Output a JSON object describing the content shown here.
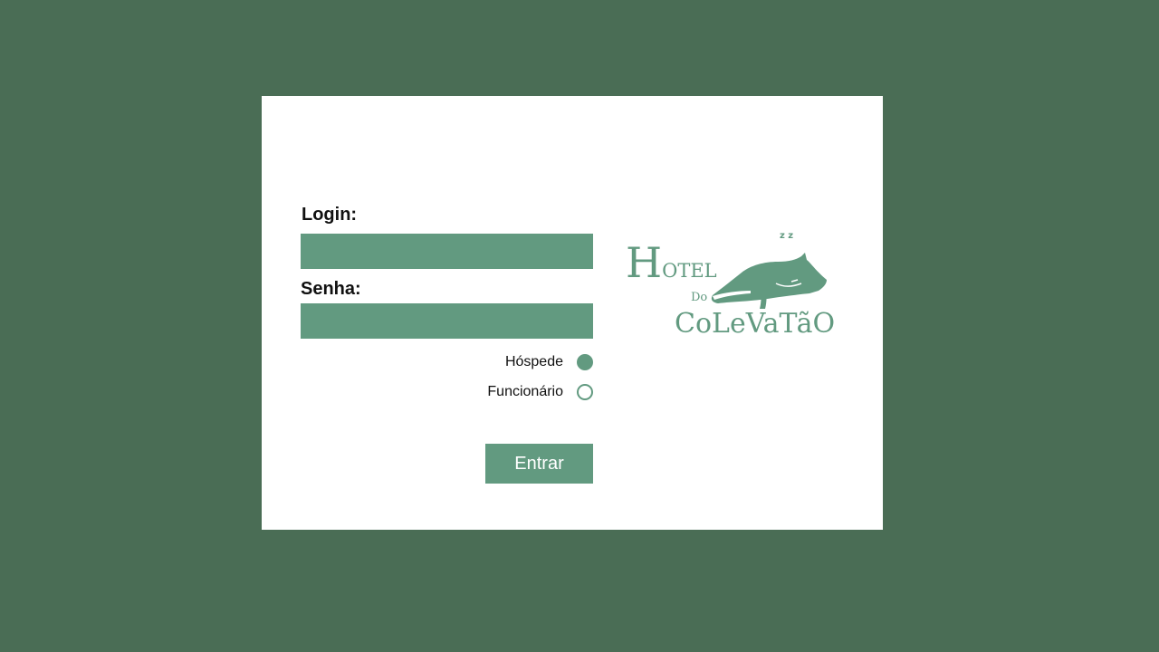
{
  "form": {
    "login_label": "Login:",
    "login_value": "",
    "senha_label": "Senha:",
    "senha_value": "",
    "role_options": [
      {
        "label": "Hóspede",
        "checked": true
      },
      {
        "label": "Funcionário",
        "checked": false
      }
    ],
    "submit_label": "Entrar"
  },
  "logo": {
    "line1_big": "H",
    "line1_rest": "OTEL",
    "line2": "Do",
    "line3": "CoLeVaTãO",
    "zz": "z z",
    "icon": "sleeping-dog-icon"
  },
  "colors": {
    "background": "#4a6d55",
    "card": "#ffffff",
    "accent": "#629a80"
  }
}
